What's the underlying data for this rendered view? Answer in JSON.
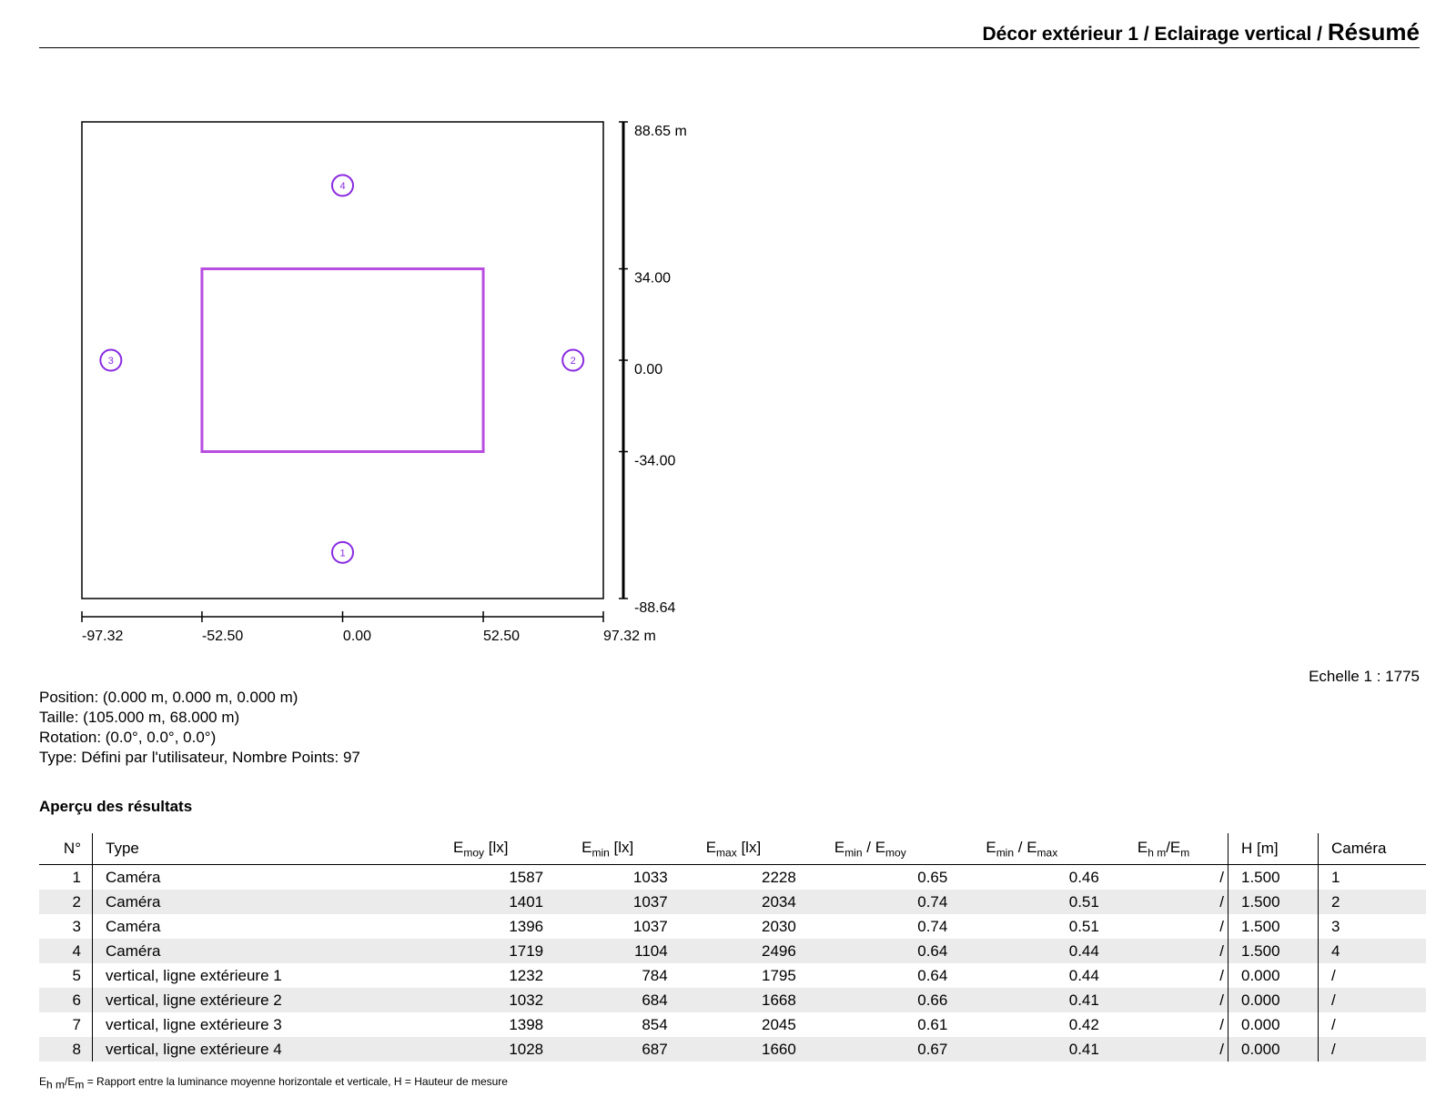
{
  "header": {
    "breadcrumb": "Décor extérieur 1 / Eclairage vertical / ",
    "page": "Résumé"
  },
  "plan": {
    "x_ticks": [
      "-97.32",
      "-52.50",
      "0.00",
      "52.50",
      "97.32 m"
    ],
    "y_ticks": [
      "88.65 m",
      "34.00",
      "0.00",
      "-34.00",
      "-88.64"
    ],
    "cameras": [
      {
        "id": "1",
        "x": 0,
        "y": -71.5
      },
      {
        "id": "2",
        "x": 86,
        "y": 0
      },
      {
        "id": "3",
        "x": -86.5,
        "y": 0
      },
      {
        "id": "4",
        "x": 0,
        "y": 65
      }
    ],
    "field": {
      "x1": -52.5,
      "x2": 52.5,
      "y1": -34,
      "y2": 34
    },
    "frame": {
      "x1": -97.32,
      "x2": 97.32,
      "y1": -88.64,
      "y2": 88.65
    },
    "field_color": "#b84ee0",
    "camera_color": "#8a2be2"
  },
  "scale_text": "Echelle 1 : 1775",
  "info": {
    "position": "Position: (0.000 m, 0.000 m, 0.000 m)",
    "size": "Taille: (105.000 m, 68.000 m)",
    "rotation": "Rotation: (0.0°, 0.0°, 0.0°)",
    "type": "Type: Défini par l'utilisateur, Nombre Points: 97"
  },
  "results": {
    "title": "Aperçu des résultats",
    "headers": {
      "no": "N°",
      "type": "Type",
      "emoy": "E",
      "emoy_sub": "moy",
      "emoy_unit": " [lx]",
      "emin": "E",
      "emin_sub": "min",
      "emin_unit": " [lx]",
      "emax": "E",
      "emax_sub": "max",
      "emax_unit": " [lx]",
      "ratio1_a": "E",
      "ratio1_a_sub": "min",
      "ratio1_sep": " / E",
      "ratio1_b_sub": "moy",
      "ratio2_a": "E",
      "ratio2_a_sub": "min",
      "ratio2_sep": " / E",
      "ratio2_b_sub": "max",
      "ehm_a": "E",
      "ehm_a_sub": "h m",
      "ehm_sep": "/E",
      "ehm_b_sub": "m",
      "h": "H [m]",
      "camera": "Caméra"
    },
    "rows": [
      {
        "no": "1",
        "type": "Caméra",
        "emoy": "1587",
        "emin": "1033",
        "emax": "2228",
        "r1": "0.65",
        "r2": "0.46",
        "ehm": "/",
        "h": "1.500",
        "cam": "1"
      },
      {
        "no": "2",
        "type": "Caméra",
        "emoy": "1401",
        "emin": "1037",
        "emax": "2034",
        "r1": "0.74",
        "r2": "0.51",
        "ehm": "/",
        "h": "1.500",
        "cam": "2"
      },
      {
        "no": "3",
        "type": "Caméra",
        "emoy": "1396",
        "emin": "1037",
        "emax": "2030",
        "r1": "0.74",
        "r2": "0.51",
        "ehm": "/",
        "h": "1.500",
        "cam": "3"
      },
      {
        "no": "4",
        "type": "Caméra",
        "emoy": "1719",
        "emin": "1104",
        "emax": "2496",
        "r1": "0.64",
        "r2": "0.44",
        "ehm": "/",
        "h": "1.500",
        "cam": "4"
      },
      {
        "no": "5",
        "type": "vertical, ligne extérieure 1",
        "emoy": "1232",
        "emin": "784",
        "emax": "1795",
        "r1": "0.64",
        "r2": "0.44",
        "ehm": "/",
        "h": "0.000",
        "cam": "/"
      },
      {
        "no": "6",
        "type": "vertical, ligne extérieure 2",
        "emoy": "1032",
        "emin": "684",
        "emax": "1668",
        "r1": "0.66",
        "r2": "0.41",
        "ehm": "/",
        "h": "0.000",
        "cam": "/"
      },
      {
        "no": "7",
        "type": "vertical, ligne extérieure 3",
        "emoy": "1398",
        "emin": "854",
        "emax": "2045",
        "r1": "0.61",
        "r2": "0.42",
        "ehm": "/",
        "h": "0.000",
        "cam": "/"
      },
      {
        "no": "8",
        "type": "vertical, ligne extérieure 4",
        "emoy": "1028",
        "emin": "687",
        "emax": "1660",
        "r1": "0.67",
        "r2": "0.41",
        "ehm": "/",
        "h": "0.000",
        "cam": "/"
      }
    ]
  },
  "footnote": {
    "e": "E",
    "hm": "h m",
    "sep": "/E",
    "m": "m",
    "text": " = Rapport entre la luminance moyenne horizontale et verticale, H = Hauteur de mesure"
  }
}
